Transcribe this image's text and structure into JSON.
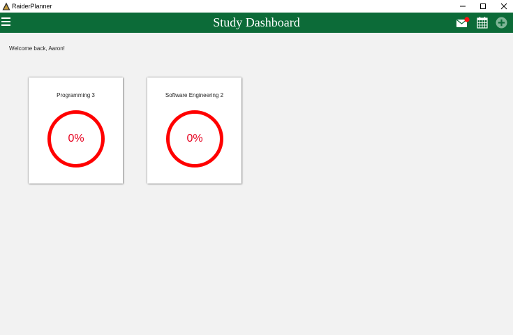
{
  "window": {
    "title": "RaiderPlanner"
  },
  "header": {
    "title": "Study Dashboard",
    "accent_color": "#0c6b38",
    "icons": [
      "hamburger-menu-icon",
      "mail-icon",
      "calendar-icon",
      "add-circle-icon"
    ]
  },
  "main": {
    "welcome": "Welcome back, Aaron!",
    "modules": [
      {
        "name": "Programming 3",
        "progress_label": "0%",
        "progress": 0
      },
      {
        "name": "Software Engineering 2",
        "progress_label": "0%",
        "progress": 0
      }
    ],
    "ring_color": "#ff0000"
  }
}
